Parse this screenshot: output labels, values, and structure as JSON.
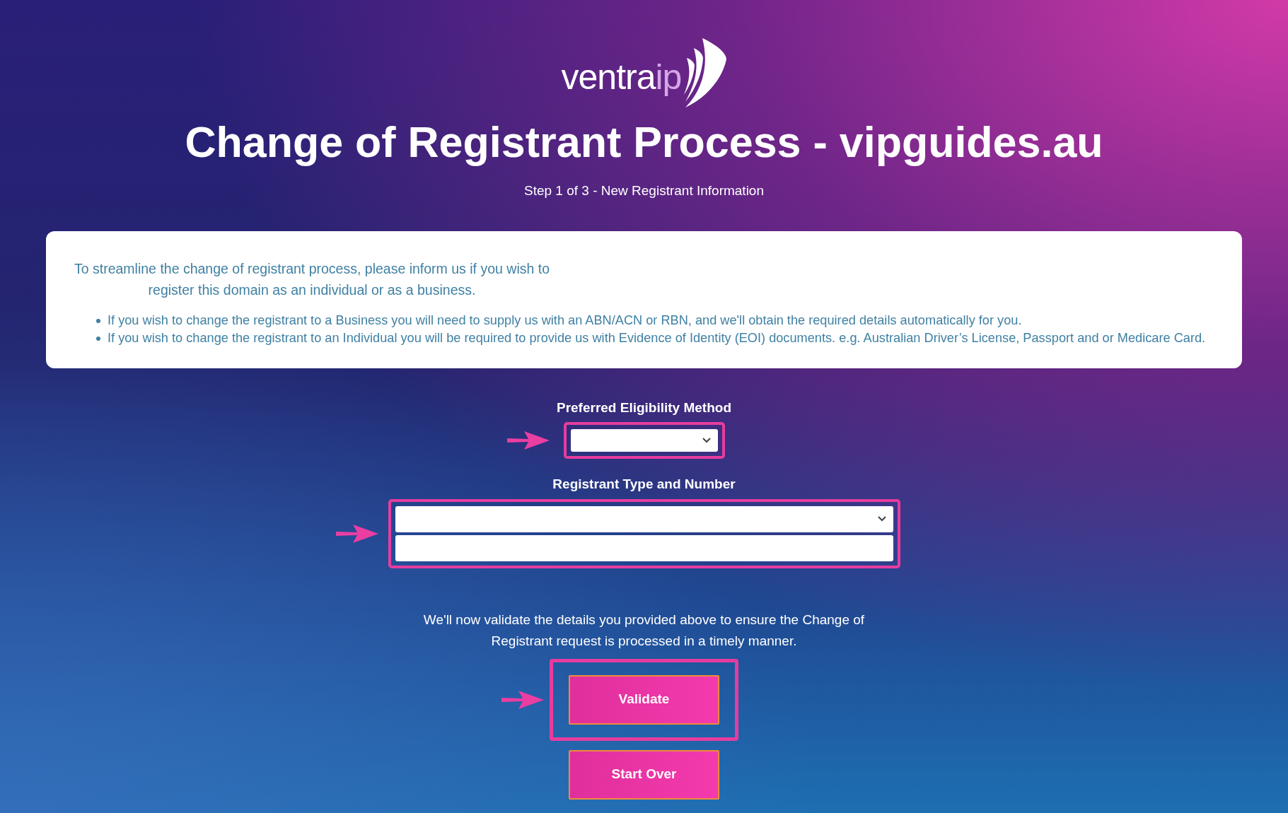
{
  "logo": {
    "main": "ventra",
    "accent": "ip"
  },
  "title": "Change of Registrant Process - vipguides.au",
  "step": "Step 1 of 3 - New Registrant Information",
  "info": {
    "intro": "To streamline the change of registrant process, please inform us if you wish to register this domain as an individual or as a business.",
    "bullets": [
      "If you wish to change the registrant to a Business you will need to supply us with an ABN/ACN or RBN, and we'll obtain the required details automatically for you.",
      "If you wish to change the registrant to an Individual you will be required to provide us with Evidence of Identity (EOI) documents. e.g. Australian Driver’s License, Passport and or Medicare Card."
    ]
  },
  "fields": [
    {
      "label": "Preferred Eligibility Method",
      "highlighted": true,
      "controls": [
        {
          "kind": "select"
        }
      ]
    },
    {
      "label": "Registrant Type and Number",
      "highlighted": true,
      "controls": [
        {
          "kind": "select"
        },
        {
          "kind": "input"
        }
      ]
    }
  ],
  "validation_note": "We'll now validate the details you provided above to ensure the Change of Registrant request is processed in a timely manner.",
  "buttons": [
    {
      "label": "Validate",
      "highlighted": true
    },
    {
      "label": "Start Over",
      "highlighted": false
    }
  ]
}
